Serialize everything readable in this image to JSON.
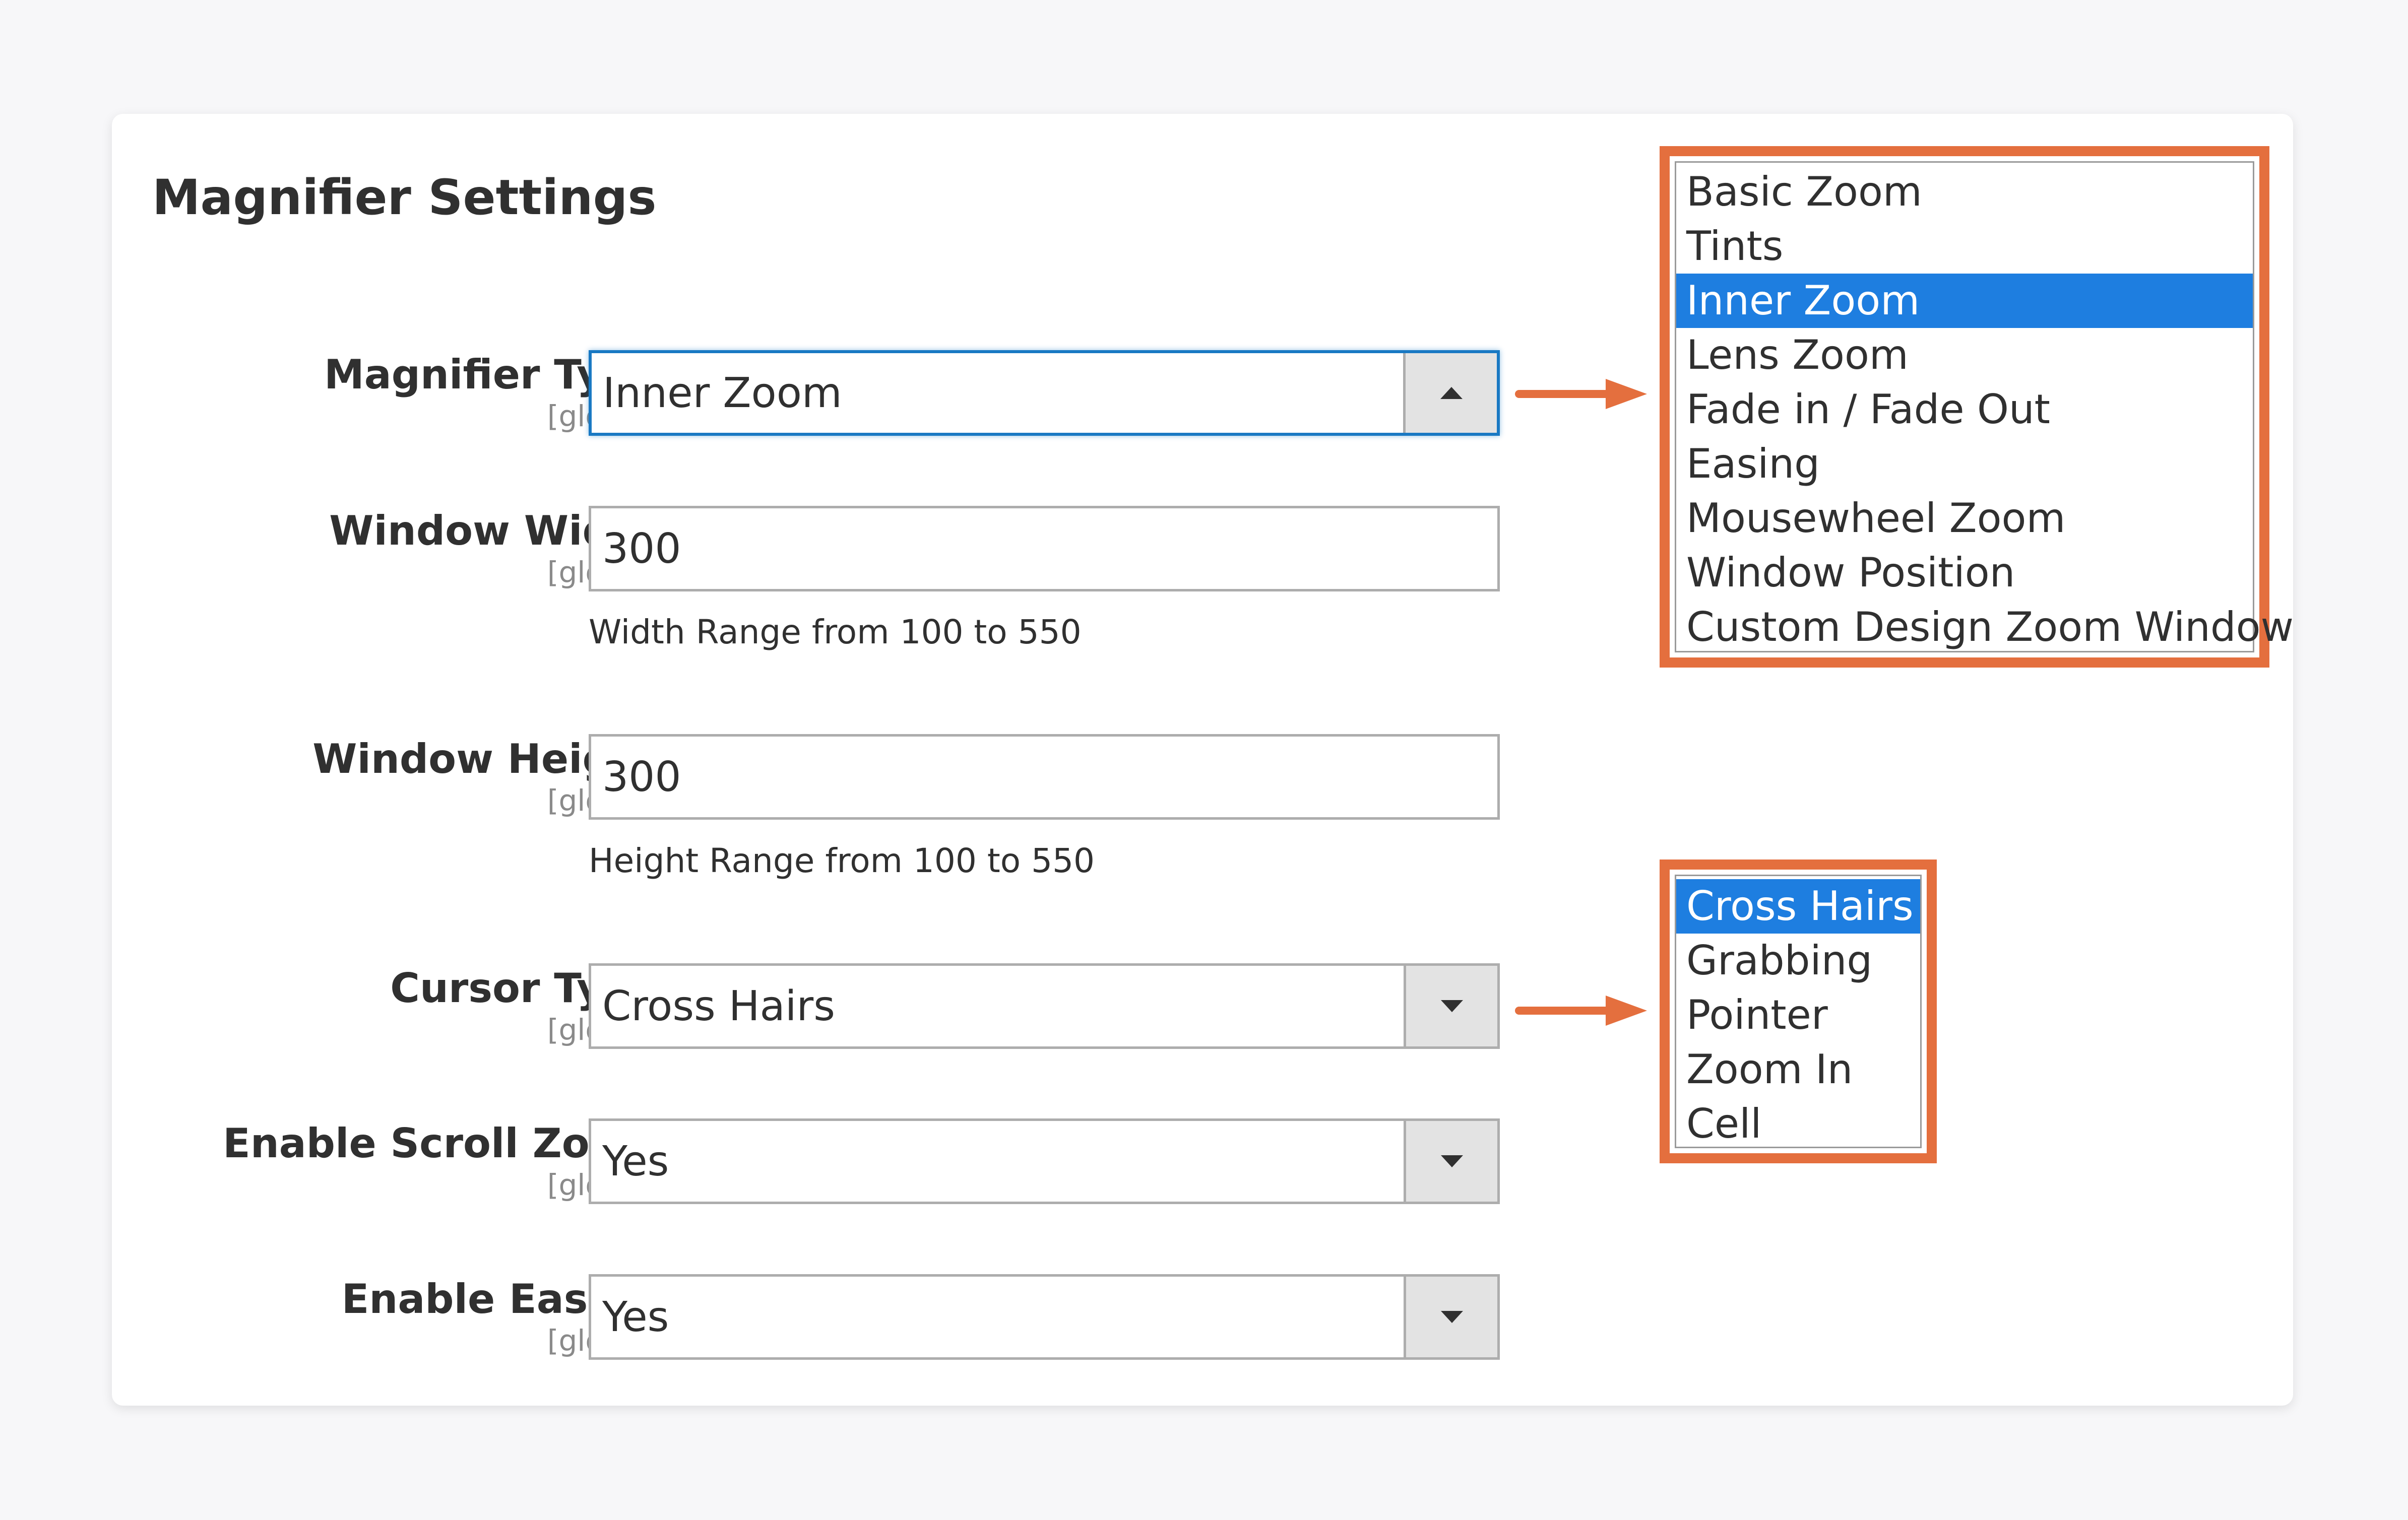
{
  "page": {
    "title": "Magnifier Settings"
  },
  "fields": {
    "magnifier_type": {
      "label": "Magnifier Type",
      "scope": "[global]",
      "value": "Inner Zoom"
    },
    "window_width": {
      "label": "Window Width",
      "scope": "[global]",
      "value": "300",
      "note": "Width Range from 100 to 550"
    },
    "window_height": {
      "label": "Window Height",
      "scope": "[global]",
      "value": "300",
      "note": "Height Range from 100 to 550"
    },
    "cursor_type": {
      "label": "Cursor Type",
      "scope": "[global]",
      "value": "Cross Hairs"
    },
    "enable_scroll_zoom": {
      "label": "Enable Scroll Zoom",
      "scope": "[global]",
      "value": "Yes"
    },
    "enable_easing": {
      "label": "Enable Easing",
      "scope": "[global]",
      "value": "Yes"
    }
  },
  "magnifier_type_options": {
    "items": [
      "Basic Zoom",
      "Tints",
      "Inner Zoom",
      "Lens Zoom",
      "Fade in / Fade Out",
      "Easing",
      "Mousewheel Zoom",
      "Window Position",
      "Custom Design Zoom Window"
    ],
    "selected_index": 2
  },
  "cursor_type_options": {
    "items": [
      "Cross Hairs",
      "Grabbing",
      "Pointer",
      "Zoom In",
      "Cell"
    ],
    "selected_index": 0
  },
  "icons": {
    "dropdown_collapsed": "chevron-down-icon",
    "dropdown_expanded": "chevron-up-icon",
    "callout_pointer": "arrow-right-icon"
  },
  "colors": {
    "callout_border": "#e46f3e",
    "selected_option": "#1e7ee0",
    "focus_border": "#1979c3"
  }
}
